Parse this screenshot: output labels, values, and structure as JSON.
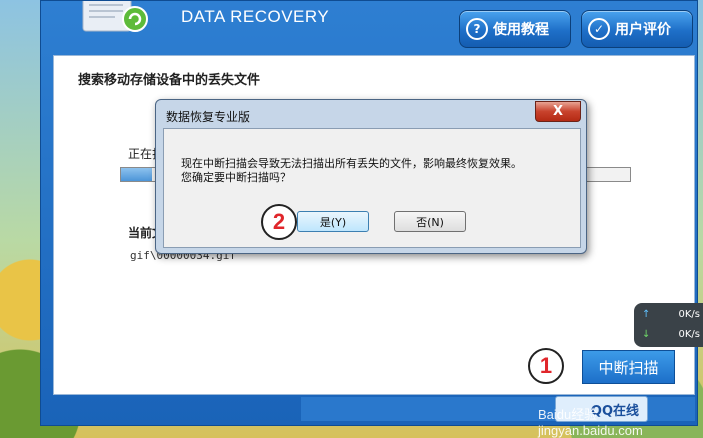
{
  "app": {
    "title": "DATA RECOVERY",
    "tutorial_btn": "使用教程",
    "review_btn": "用户评价",
    "heading": "搜索移动存储设备中的丢失文件",
    "scan_label": "正在扫描",
    "progress": 0.06,
    "current_file_label": "当前文件",
    "current_file_path": "gif\\00000034.gif",
    "stop_btn": "中断扫描",
    "qq_btn": "QQ在线"
  },
  "speed": {
    "up": "0K/s",
    "down": "0K/s"
  },
  "dialog": {
    "title": "数据恢复专业版",
    "message_line1": "现在中断扫描会导致无法扫描出所有丢失的文件，影响最终恢复效果。",
    "message_line2": "您确定要中断扫描吗？",
    "yes": "是(Y)",
    "no": "否(N)",
    "close": "X"
  },
  "markers": {
    "one": "1",
    "two": "2"
  },
  "watermark": "Baidu经验 jingyan.baidu.com"
}
